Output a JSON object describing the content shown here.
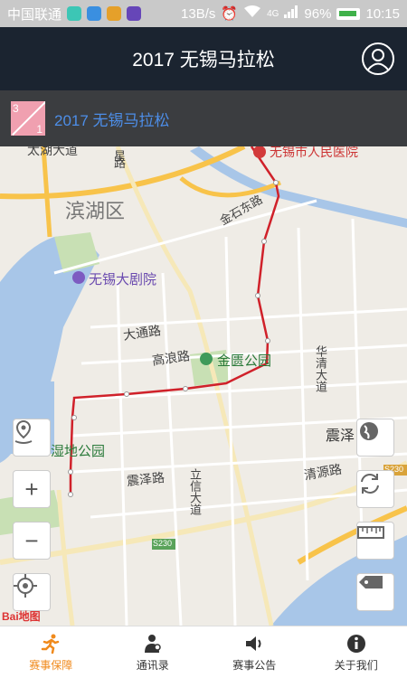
{
  "status_bar": {
    "carrier": "中国联通",
    "network_speed": "13B/s",
    "network_type": "4G",
    "battery": "96%",
    "time": "10:15"
  },
  "header": {
    "title": "2017 无锡马拉松"
  },
  "route": {
    "badge_top": "3",
    "badge_bottom": "1",
    "name": "2017 无锡马拉松"
  },
  "map": {
    "labels": {
      "taihu": "太湖大道",
      "hospital": "无锡市人民医院",
      "binhu": "滨湖区",
      "jinshi": "金石东路",
      "grand_theatre": "无锡大剧院",
      "datong": "大通路",
      "gaolang": "高浪路",
      "jinkuang": "金匮公园",
      "huaqing": "华清大道",
      "zhenze_east": "震泽",
      "wetland": "湿地公园",
      "zhenze": "震泽路",
      "lixin": "立信大道",
      "qingyuan": "清源路",
      "s230": "S230",
      "s230b": "S230",
      "star": "星",
      "road": "路"
    },
    "brand": "Bai地图"
  },
  "nav": [
    {
      "label": "赛事保障",
      "icon": "runner-icon",
      "active": true
    },
    {
      "label": "通讯录",
      "icon": "contacts-icon",
      "active": false
    },
    {
      "label": "赛事公告",
      "icon": "speaker-icon",
      "active": false
    },
    {
      "label": "关于我们",
      "icon": "info-icon",
      "active": false
    }
  ],
  "colors": {
    "header_bg": "#1b2430",
    "route_bar_bg": "#3b3d40",
    "route_line": "#d0212a",
    "active_nav": "#f08a1c"
  }
}
